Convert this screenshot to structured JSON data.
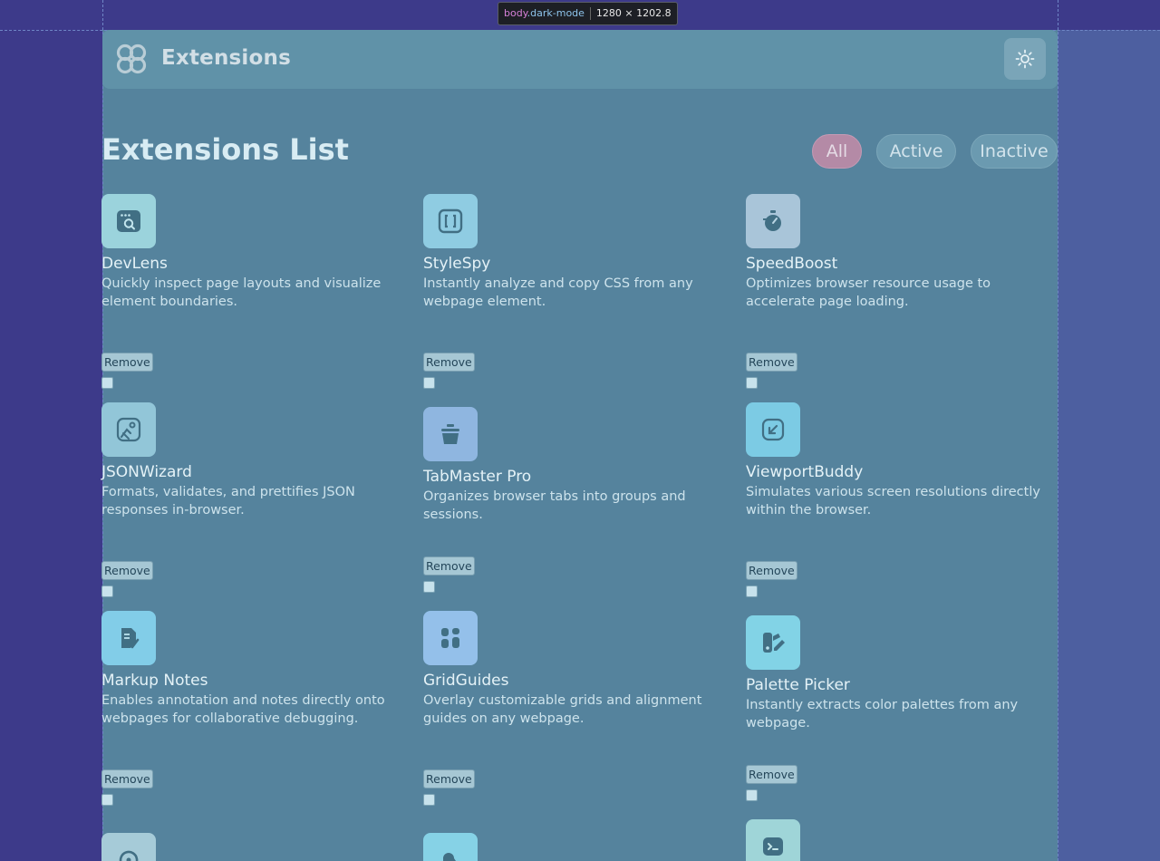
{
  "inspector": {
    "tag": "body",
    "class": ".dark-mode",
    "size": "1280 × 1202.8"
  },
  "header": {
    "logo_label": "Extensions",
    "theme_toggle_icon": "sun-icon"
  },
  "page": {
    "title": "Extensions List"
  },
  "filters": [
    {
      "label": "All",
      "active": true
    },
    {
      "label": "Active",
      "active": false
    },
    {
      "label": "Inactive",
      "active": false
    }
  ],
  "extensions": [
    {
      "name": "DevLens",
      "description": "Quickly inspect page layouts and visualize element boundaries.",
      "remove_label": "Remove",
      "icon": "search-window-icon",
      "icon_color": "#9bd3dc"
    },
    {
      "name": "StyleSpy",
      "description": "Instantly analyze and copy CSS from any webpage element.",
      "remove_label": "Remove",
      "icon": "code-brackets-icon",
      "icon_color": "#8fcce2"
    },
    {
      "name": "SpeedBoost",
      "description": "Optimizes browser resource usage to accelerate page loading.",
      "remove_label": "Remove",
      "icon": "stopwatch-icon",
      "icon_color": "#a9c5d9"
    },
    {
      "name": "JSONWizard",
      "description": "Formats, validates, and prettifies JSON responses in-browser.",
      "remove_label": "Remove",
      "icon": "magic-image-icon",
      "icon_color": "#92c6d8"
    },
    {
      "name": "TabMaster Pro",
      "description": "Organizes browser tabs into groups and sessions.",
      "remove_label": "Remove",
      "icon": "jar-icon",
      "icon_color": "#8fb6e0"
    },
    {
      "name": "ViewportBuddy",
      "description": "Simulates various screen resolutions directly within the browser.",
      "remove_label": "Remove",
      "icon": "resize-arrow-icon",
      "icon_color": "#7ccbe4"
    },
    {
      "name": "Markup Notes",
      "description": "Enables annotation and notes directly onto webpages for collaborative debugging.",
      "remove_label": "Remove",
      "icon": "note-pencil-icon",
      "icon_color": "#82cde8"
    },
    {
      "name": "GridGuides",
      "description": "Overlay customizable grids and alignment guides on any webpage.",
      "remove_label": "Remove",
      "icon": "grid-blocks-icon",
      "icon_color": "#94c0ea"
    },
    {
      "name": "Palette Picker",
      "description": "Instantly extracts color palettes from any webpage.",
      "remove_label": "Remove",
      "icon": "palette-icon",
      "icon_color": "#82d3e6"
    },
    {
      "name": "",
      "description": "",
      "remove_label": "",
      "icon": "refresh-icon",
      "icon_color": "#a6cbd8"
    },
    {
      "name": "",
      "description": "",
      "remove_label": "",
      "icon": "document-icon",
      "icon_color": "#86d2e6"
    },
    {
      "name": "",
      "description": "",
      "remove_label": "",
      "icon": "terminal-icon",
      "icon_color": "#9fd5d8"
    }
  ]
}
